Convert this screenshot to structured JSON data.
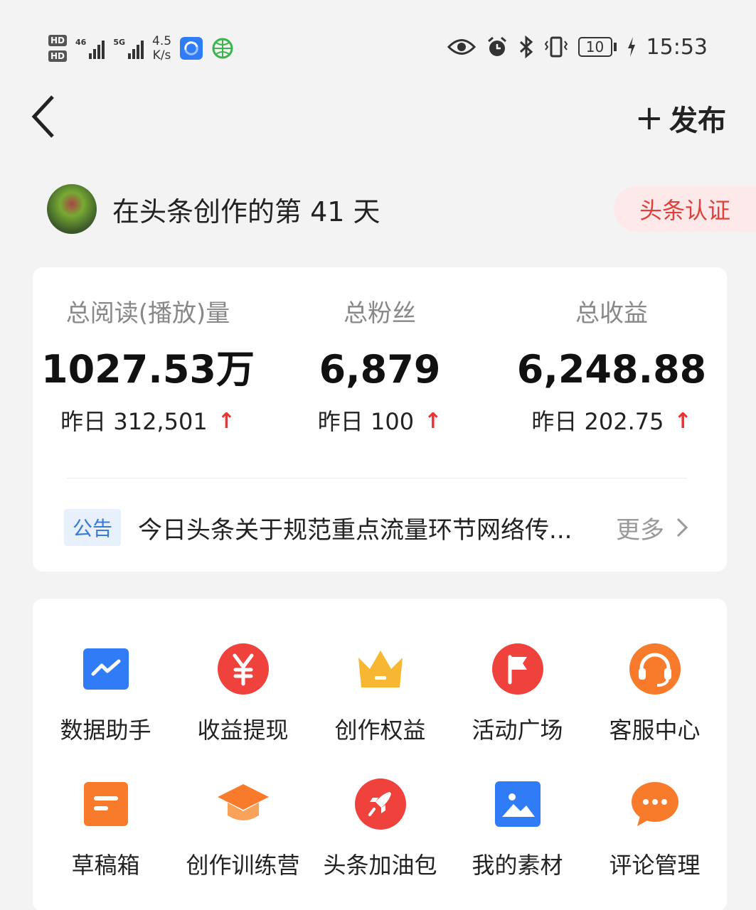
{
  "status_bar": {
    "hd1": "HD",
    "hd2": "HD",
    "sig1": "46",
    "sig2": "5G",
    "speed_value": "4.5",
    "speed_unit": "K/s",
    "battery": "10",
    "time": "15:53"
  },
  "nav": {
    "publish_label": "发布",
    "plus": "+"
  },
  "creator": {
    "days_text": "在头条创作的第 41 天",
    "cert_label": "头条认证"
  },
  "stats": [
    {
      "label": "总阅读(播放)量",
      "value": "1027.53万",
      "delta": "昨日 312,501",
      "trend": "↑"
    },
    {
      "label": "总粉丝",
      "value": "6,879",
      "delta": "昨日 100",
      "trend": "↑"
    },
    {
      "label": "总收益",
      "value": "6,248.88",
      "delta": "昨日 202.75",
      "trend": "↑"
    }
  ],
  "notice": {
    "tag": "公告",
    "text": "今日头条关于规范重点流量环节网络传...",
    "more": "更多"
  },
  "tools": [
    {
      "label": "数据助手",
      "icon": "chart-icon",
      "color": "#2f7cf6"
    },
    {
      "label": "收益提现",
      "icon": "yuan-icon",
      "color": "#f0423d"
    },
    {
      "label": "创作权益",
      "icon": "crown-icon",
      "color": "#f7b731"
    },
    {
      "label": "活动广场",
      "icon": "flag-icon",
      "color": "#f0423d"
    },
    {
      "label": "客服中心",
      "icon": "headset-icon",
      "color": "#f77b2b"
    },
    {
      "label": "草稿箱",
      "icon": "draft-icon",
      "color": "#f77b2b"
    },
    {
      "label": "创作训练营",
      "icon": "graduation-cap-icon",
      "color": "#f77b2b"
    },
    {
      "label": "头条加油包",
      "icon": "rocket-icon",
      "color": "#f0423d"
    },
    {
      "label": "我的素材",
      "icon": "image-icon",
      "color": "#2f7cf6"
    },
    {
      "label": "评论管理",
      "icon": "comment-icon",
      "color": "#f77b2b"
    }
  ]
}
